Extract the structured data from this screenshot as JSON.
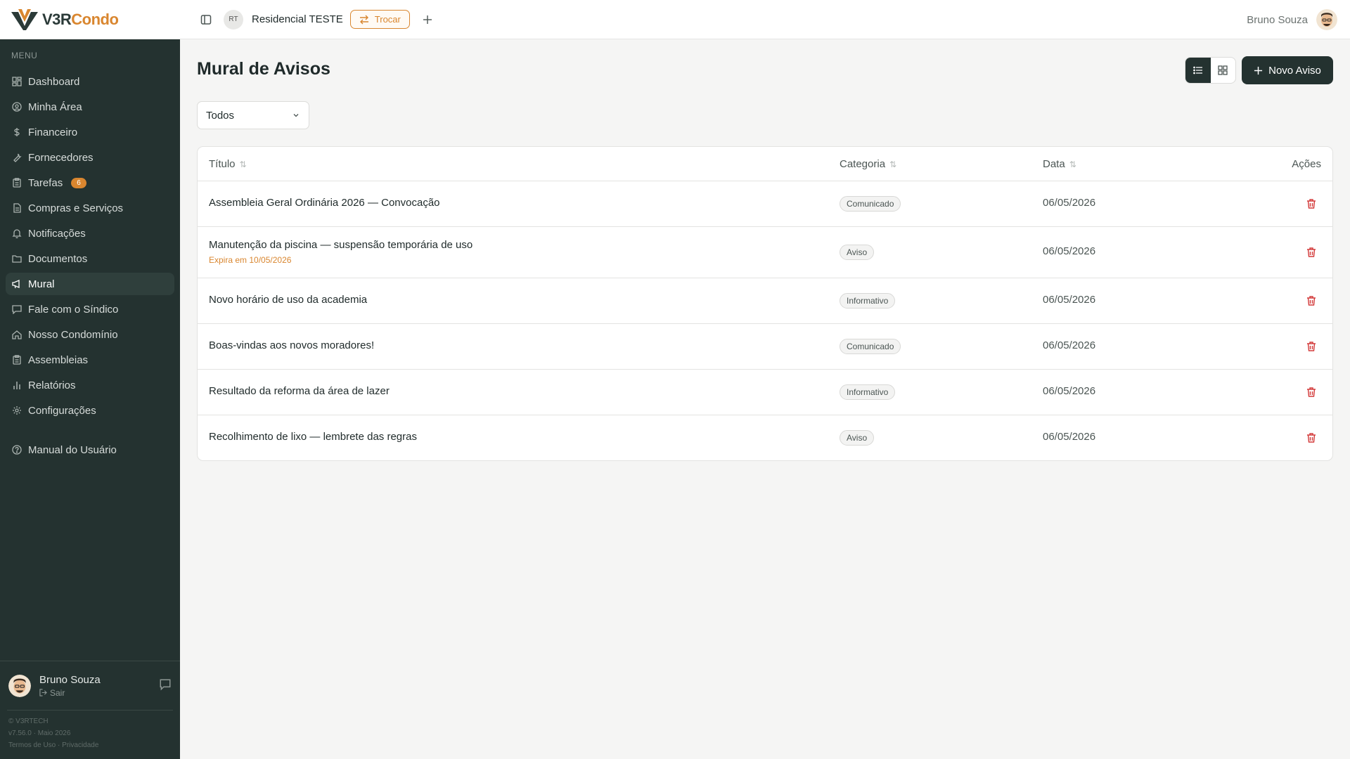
{
  "brand": {
    "logo_v3r": "V3R",
    "logo_condo": "Condo",
    "logo_colors": {
      "dark": "#2b3a38",
      "accent": "#d9862f"
    }
  },
  "topbar": {
    "condo_initials": "RT",
    "condo_name": "Residencial TESTE",
    "switch_label": "Trocar",
    "user_name": "Bruno Souza"
  },
  "sidebar": {
    "menu_label": "MENU",
    "items": [
      {
        "label": "Dashboard",
        "icon": "dashboard-icon"
      },
      {
        "label": "Minha Área",
        "icon": "user-circle-icon"
      },
      {
        "label": "Financeiro",
        "icon": "dollar-icon"
      },
      {
        "label": "Fornecedores",
        "icon": "wrench-icon"
      },
      {
        "label": "Tarefas",
        "icon": "clipboard-icon",
        "badge": "6"
      },
      {
        "label": "Compras e Serviços",
        "icon": "document-icon"
      },
      {
        "label": "Notificações",
        "icon": "bell-icon"
      },
      {
        "label": "Documentos",
        "icon": "folder-icon"
      },
      {
        "label": "Mural",
        "icon": "megaphone-icon",
        "active": true
      },
      {
        "label": "Fale com o Síndico",
        "icon": "chat-icon"
      },
      {
        "label": "Nosso Condomínio",
        "icon": "home-icon"
      },
      {
        "label": "Assembleias",
        "icon": "clipboard-icon"
      },
      {
        "label": "Relatórios",
        "icon": "bar-chart-icon"
      },
      {
        "label": "Configurações",
        "icon": "gear-icon"
      },
      {
        "label": "Manual do Usuário",
        "icon": "help-circle-icon"
      }
    ],
    "user_name": "Bruno Souza",
    "logout_label": "Sair",
    "footer_copyright": "© V3RTECH",
    "footer_version": "v7.56.0 · Maio 2026",
    "footer_terms": "Termos de Uso",
    "footer_separator": "·",
    "footer_privacy": "Privacidade"
  },
  "main": {
    "title": "Mural de Avisos",
    "new_button_label": "Novo Aviso",
    "filter_value": "Todos",
    "columns": {
      "title": "Título",
      "category": "Categoria",
      "date": "Data",
      "actions": "Ações"
    },
    "rows": [
      {
        "title": "Assembleia Geral Ordinária 2026 — Convocação",
        "category": "Comunicado",
        "date": "06/05/2026"
      },
      {
        "title": "Manutenção da piscina — suspensão temporária de uso",
        "expires": "Expira em 10/05/2026",
        "category": "Aviso",
        "date": "06/05/2026"
      },
      {
        "title": "Novo horário de uso da academia",
        "category": "Informativo",
        "date": "06/05/2026"
      },
      {
        "title": "Boas-vindas aos novos moradores!",
        "category": "Comunicado",
        "date": "06/05/2026"
      },
      {
        "title": "Resultado da reforma da área de lazer",
        "category": "Informativo",
        "date": "06/05/2026"
      },
      {
        "title": "Recolhimento de lixo — lembrete das regras",
        "category": "Aviso",
        "date": "06/05/2026"
      }
    ]
  },
  "colors": {
    "sidebar_bg": "#243230",
    "accent": "#d9862f",
    "danger": "#d33a3a",
    "page_bg": "#f5f5f4"
  }
}
